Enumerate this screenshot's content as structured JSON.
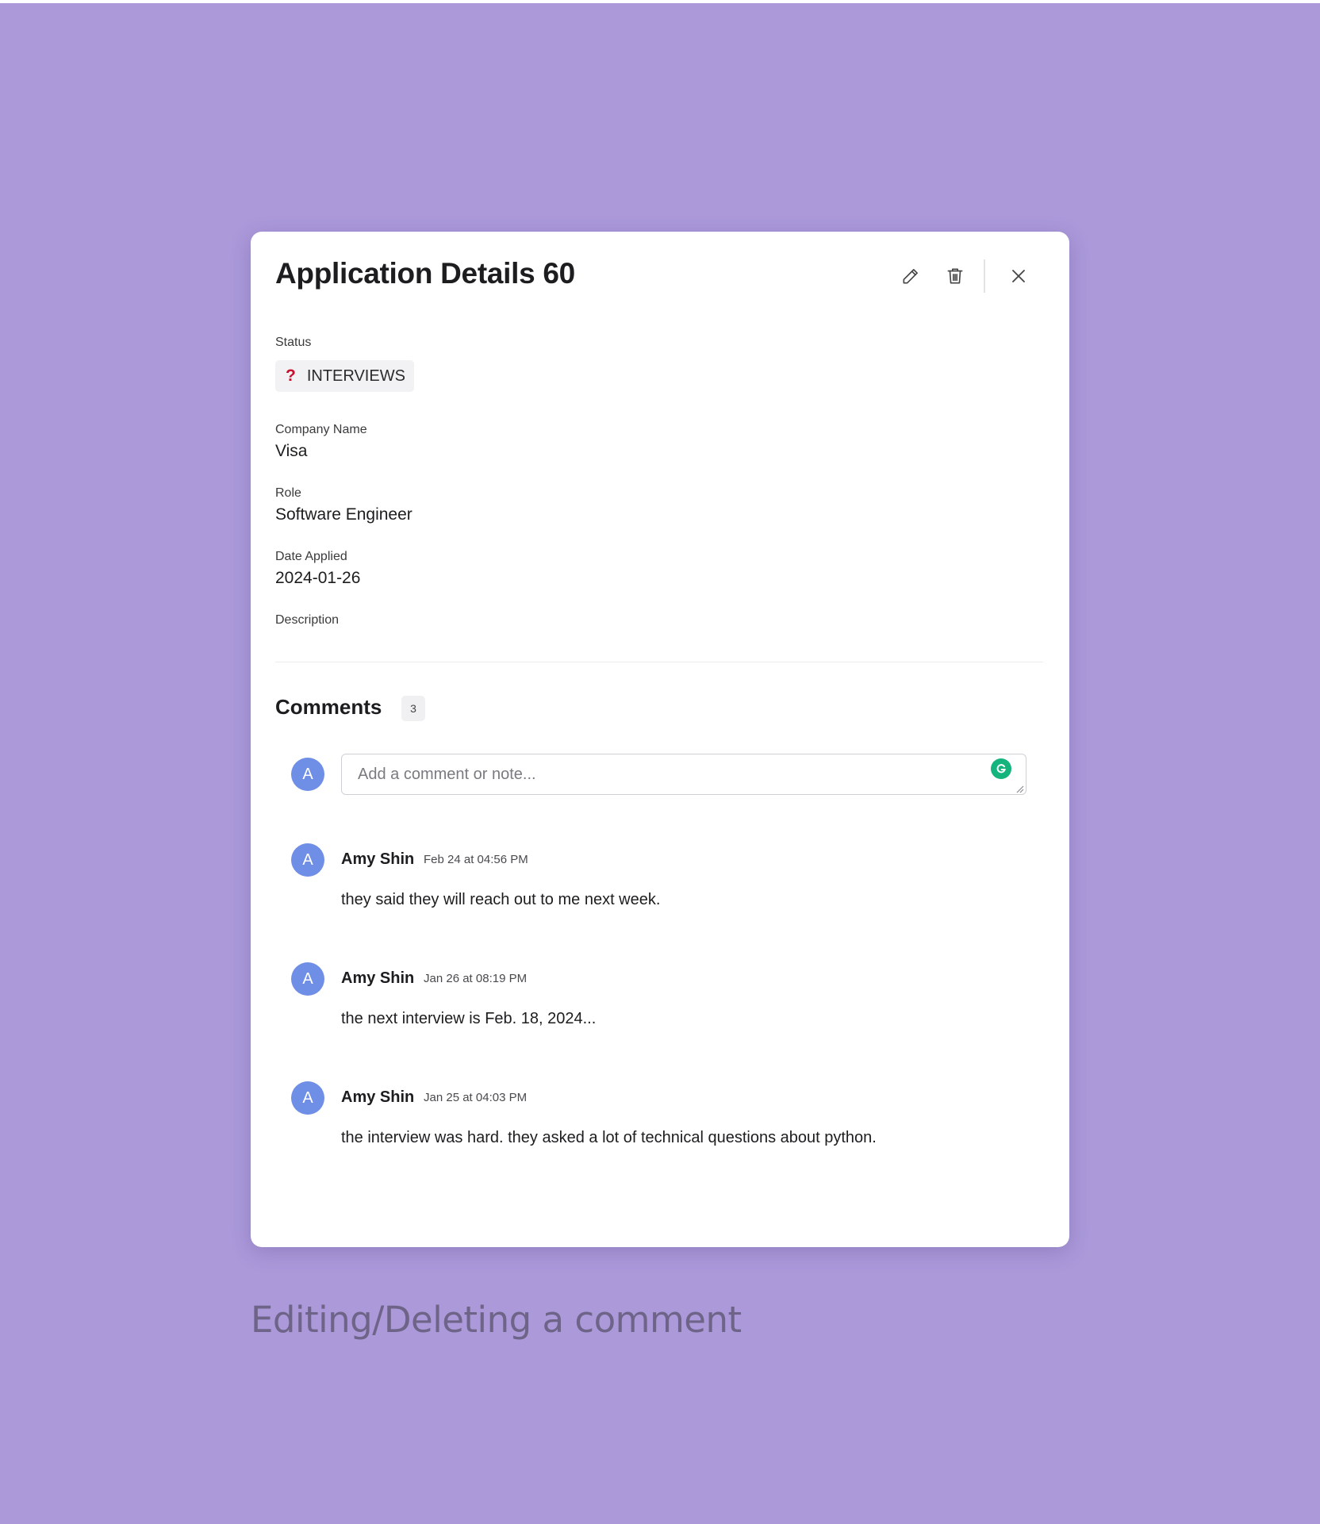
{
  "modal": {
    "title": "Application Details 60",
    "actions": {
      "edit_icon": "pencil-icon",
      "delete_icon": "trash-icon",
      "close_icon": "close-icon"
    }
  },
  "fields": {
    "status": {
      "label": "Status",
      "icon": "?",
      "value": "INTERVIEWS",
      "icon_color": "#c8102e"
    },
    "company": {
      "label": "Company Name",
      "value": "Visa"
    },
    "role": {
      "label": "Role",
      "value": "Software Engineer"
    },
    "date_applied": {
      "label": "Date Applied",
      "value": "2024-01-26"
    },
    "description": {
      "label": "Description",
      "value": ""
    }
  },
  "comments": {
    "title": "Comments",
    "count": "3",
    "input": {
      "avatar": "A",
      "placeholder": "Add a comment or note...",
      "value": ""
    },
    "items": [
      {
        "avatar": "A",
        "author": "Amy Shin",
        "time": "Feb 24 at 04:56 PM",
        "body": "they said they will reach out to me next week."
      },
      {
        "avatar": "A",
        "author": "Amy Shin",
        "time": "Jan 26 at 08:19 PM",
        "body": "the next interview is Feb. 18, 2024..."
      },
      {
        "avatar": "A",
        "author": "Amy Shin",
        "time": "Jan 25 at 04:03 PM",
        "body": "the interview was hard. they asked a lot of technical questions about python."
      }
    ]
  },
  "caption": "Editing/Deleting a comment",
  "colors": {
    "background": "#ab99da",
    "avatar": "#6f8ee6",
    "grammarly": "#15b47d"
  }
}
